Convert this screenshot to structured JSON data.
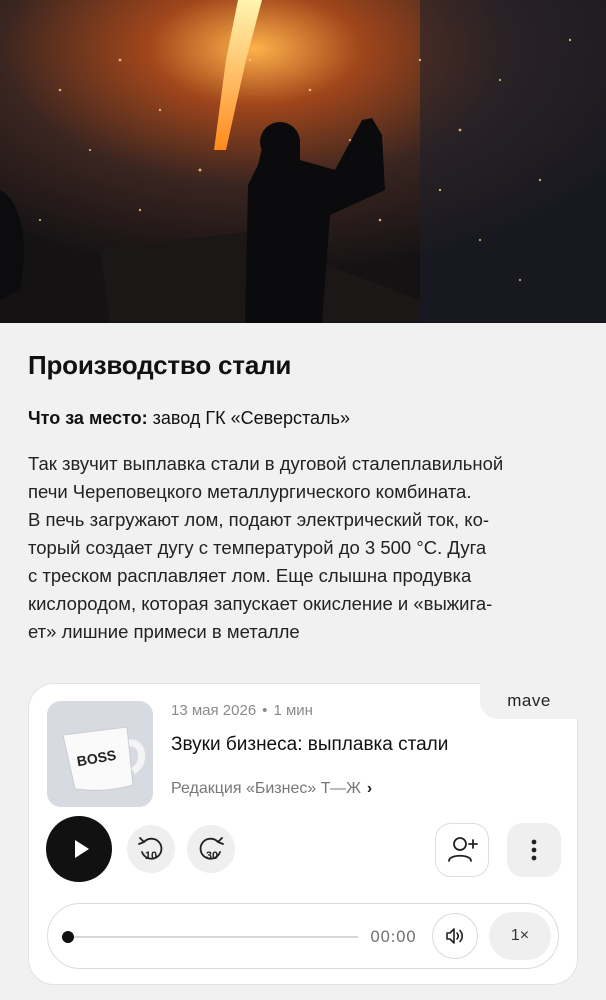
{
  "article": {
    "title": "Производство стали",
    "place_label": "Что за место:",
    "place_value": " завод ГК «Северсталь»",
    "description_lines": [
      "Так звучит выплавка стали в дуговой сталеплавильной",
      "печи Череповецкого металлургического комбината.",
      "В печь загружают лом, подают электрический ток, ко-",
      "торый создает дугу с температурой до 3 500 °C. Дуга",
      "с треском расплавляет лом. Еще слышна продувка",
      "кислородом, которая запускает окисление и «выжига-",
      "ет» лишние примеси в металле"
    ]
  },
  "player": {
    "brand": "mave",
    "cover_text": "BOSS",
    "date": "13 мая 2026",
    "separator": "•",
    "duration": "1 мин",
    "episode_title": "Звуки бизнеса: выплавка стали",
    "author": "Редакция «Бизнес» Т—Ж",
    "author_chevron": "›",
    "rewind_label": "10",
    "forward_label": "30",
    "current_time": "00:00",
    "speed": "1×",
    "progress": 0
  },
  "icons": {
    "play": "play-icon",
    "rewind": "rewind-10-icon",
    "forward": "forward-30-icon",
    "subscribe": "add-user-icon",
    "more": "more-vertical-icon",
    "volume": "volume-icon"
  }
}
